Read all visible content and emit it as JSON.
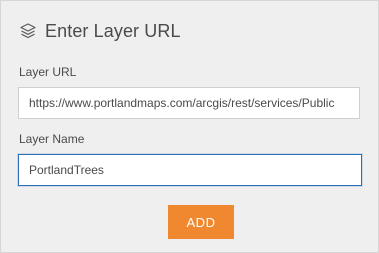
{
  "header": {
    "icon": "layers-icon",
    "title": "Enter Layer URL"
  },
  "form": {
    "url_label": "Layer URL",
    "url_value": "https://www.portlandmaps.com/arcgis/rest/services/Public",
    "name_label": "Layer Name",
    "name_value": "PortlandTrees"
  },
  "actions": {
    "add_label": "ADD"
  },
  "colors": {
    "panel_bg": "#efefef",
    "accent": "#f0882f",
    "focus_border": "#2a6ebb"
  }
}
